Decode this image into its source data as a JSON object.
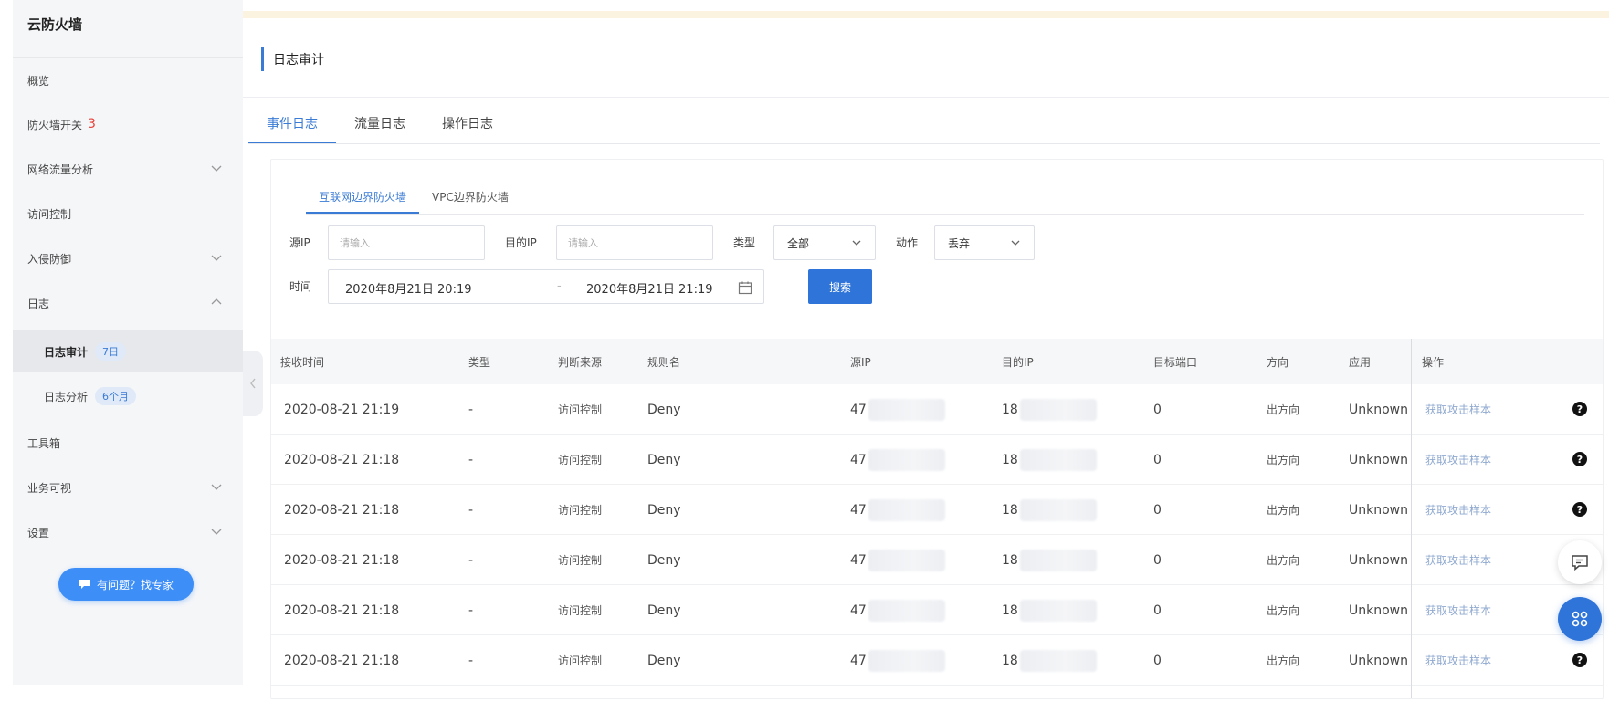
{
  "sidebar": {
    "brand": "云防火墙",
    "items": [
      {
        "label": "概览"
      },
      {
        "label": "防火墙开关",
        "badge": "3"
      },
      {
        "label": "网络流量分析"
      },
      {
        "label": "访问控制"
      },
      {
        "label": "入侵防御"
      },
      {
        "label": "日志"
      },
      {
        "label": "日志审计",
        "pill": "7日"
      },
      {
        "label": "日志分析",
        "pill": "6个月"
      },
      {
        "label": "工具箱"
      },
      {
        "label": "业务可视"
      },
      {
        "label": "设置"
      }
    ],
    "expert_button": "有问题？找专家"
  },
  "page": {
    "title": "日志审计",
    "tabs": [
      "事件日志",
      "流量日志",
      "操作日志"
    ],
    "active_tab": "事件日志"
  },
  "card": {
    "subtabs": [
      "互联网边界防火墙",
      "VPC边界防火墙"
    ],
    "active_subtab": "互联网边界防火墙",
    "filters": {
      "src_ip_label": "源IP",
      "src_ip_placeholder": "请输入",
      "dst_ip_label": "目的IP",
      "dst_ip_placeholder": "请输入",
      "type_label": "类型",
      "type_value": "全部",
      "action_label": "动作",
      "action_value": "丢弃",
      "time_label": "时间",
      "time_start": "2020年8月21日 20:19",
      "time_separator": "-",
      "time_end": "2020年8月21日 21:19",
      "search_button": "搜索"
    },
    "table": {
      "columns": [
        "接收时间",
        "类型",
        "判断来源",
        "规则名",
        "源IP",
        "目的IP",
        "目标端口",
        "方向",
        "应用",
        "操作"
      ],
      "rows": [
        {
          "time": "2020-08-21 21:19",
          "type": "-",
          "source": "访问控制",
          "rule": "Deny",
          "src_ip": "47",
          "dst_ip": "18",
          "port": "0",
          "direction": "出方向",
          "app": "Unknown",
          "action": "获取攻击样本"
        },
        {
          "time": "2020-08-21 21:18",
          "type": "-",
          "source": "访问控制",
          "rule": "Deny",
          "src_ip": "47",
          "dst_ip": "18",
          "port": "0",
          "direction": "出方向",
          "app": "Unknown",
          "action": "获取攻击样本"
        },
        {
          "time": "2020-08-21 21:18",
          "type": "-",
          "source": "访问控制",
          "rule": "Deny",
          "src_ip": "47",
          "dst_ip": "18",
          "port": "0",
          "direction": "出方向",
          "app": "Unknown",
          "action": "获取攻击样本"
        },
        {
          "time": "2020-08-21 21:18",
          "type": "-",
          "source": "访问控制",
          "rule": "Deny",
          "src_ip": "47",
          "dst_ip": "18",
          "port": "0",
          "direction": "出方向",
          "app": "Unknown",
          "action": "获取攻击样本"
        },
        {
          "time": "2020-08-21 21:18",
          "type": "-",
          "source": "访问控制",
          "rule": "Deny",
          "src_ip": "47",
          "dst_ip": "18",
          "port": "0",
          "direction": "出方向",
          "app": "Unknown",
          "action": "获取攻击样本"
        },
        {
          "time": "2020-08-21 21:18",
          "type": "-",
          "source": "访问控制",
          "rule": "Deny",
          "src_ip": "47",
          "dst_ip": "18",
          "port": "0",
          "direction": "出方向",
          "app": "Unknown",
          "action": "获取攻击样本"
        }
      ]
    }
  },
  "colors": {
    "accent": "#3a7bd5",
    "button": "#2f74d9",
    "badge_red": "#e8423b",
    "link_muted": "#8fa9cf"
  },
  "icons": {
    "chevron": "chevron-down-icon",
    "help": "question-circle-icon",
    "chat": "chat-icon",
    "apps": "apps-icon",
    "calendar": "calendar-icon"
  }
}
